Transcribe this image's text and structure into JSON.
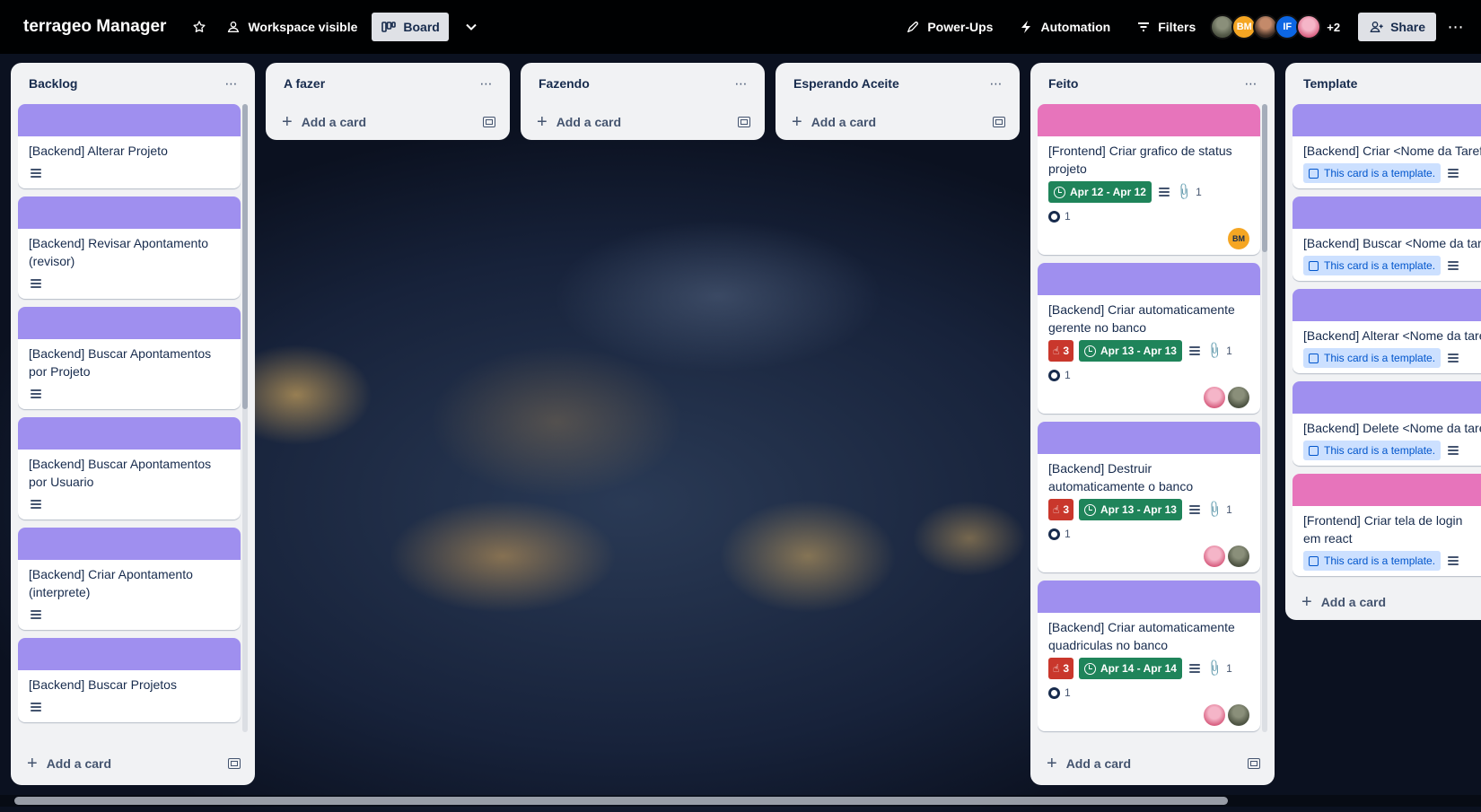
{
  "header": {
    "board_title": "terrageo Manager",
    "visibility_label": "Workspace visible",
    "view_label": "Board",
    "powerups_label": "Power-Ups",
    "automation_label": "Automation",
    "filters_label": "Filters",
    "members": [
      {
        "initials": ""
      },
      {
        "initials": "BM"
      },
      {
        "initials": ""
      },
      {
        "initials": "IF"
      },
      {
        "initials": ""
      }
    ],
    "more_members": "+2",
    "share_label": "Share"
  },
  "lists": {
    "backlog": {
      "title": "Backlog",
      "add_label": "Add a card",
      "cards": [
        {
          "title": "[Backend] Alterar Projeto"
        },
        {
          "title": "[Backend] Revisar Apontamento (revisor)"
        },
        {
          "title": "[Backend] Buscar Apontamentos por Projeto"
        },
        {
          "title": "[Backend] Buscar Apontamentos por Usuario"
        },
        {
          "title": "[Backend] Criar Apontamento (interprete)"
        },
        {
          "title": "[Backend] Buscar Projetos"
        }
      ]
    },
    "afazer": {
      "title": "A fazer",
      "add_label": "Add a card"
    },
    "fazendo": {
      "title": "Fazendo",
      "add_label": "Add a card"
    },
    "esperando": {
      "title": "Esperando Aceite",
      "add_label": "Add a card"
    },
    "feito": {
      "title": "Feito",
      "add_label": "Add a card",
      "cards": [
        {
          "title": "[Frontend] Criar grafico de status projeto",
          "date": "Apr 12 - Apr 12",
          "attachments": "1",
          "github": "1",
          "member": "BM"
        },
        {
          "title": "[Backend] Criar automaticamente gerente no banco",
          "votes": "3",
          "date": "Apr 13 - Apr 13",
          "attachments": "1",
          "github": "1"
        },
        {
          "title": "[Backend] Destruir automaticamente o banco",
          "votes": "3",
          "date": "Apr 13 - Apr 13",
          "attachments": "1",
          "github": "1"
        },
        {
          "title": "[Backend] Criar automaticamente quadriculas no banco",
          "votes": "3",
          "date": "Apr 14 - Apr 14",
          "attachments": "1",
          "github": "1"
        }
      ]
    },
    "template": {
      "title": "Template",
      "add_label": "Add a card",
      "template_badge": "This card is a template.",
      "cards": [
        {
          "title": "[Backend] Criar <Nome da Tarefa>"
        },
        {
          "title": "[Backend] Buscar <Nome da tarefa>"
        },
        {
          "title": "[Backend] Alterar <Nome da tarefa>"
        },
        {
          "title": "[Backend] Delete <Nome da tarefa>"
        },
        {
          "title": "[Frontend] Criar tela de login em react"
        }
      ]
    }
  },
  "colors": {
    "cover_purple": "#9f8fef",
    "cover_pink": "#e774bb",
    "date_green": "#1f845a",
    "vote_red": "#c9372c",
    "template_blue": "#cce0ff"
  }
}
